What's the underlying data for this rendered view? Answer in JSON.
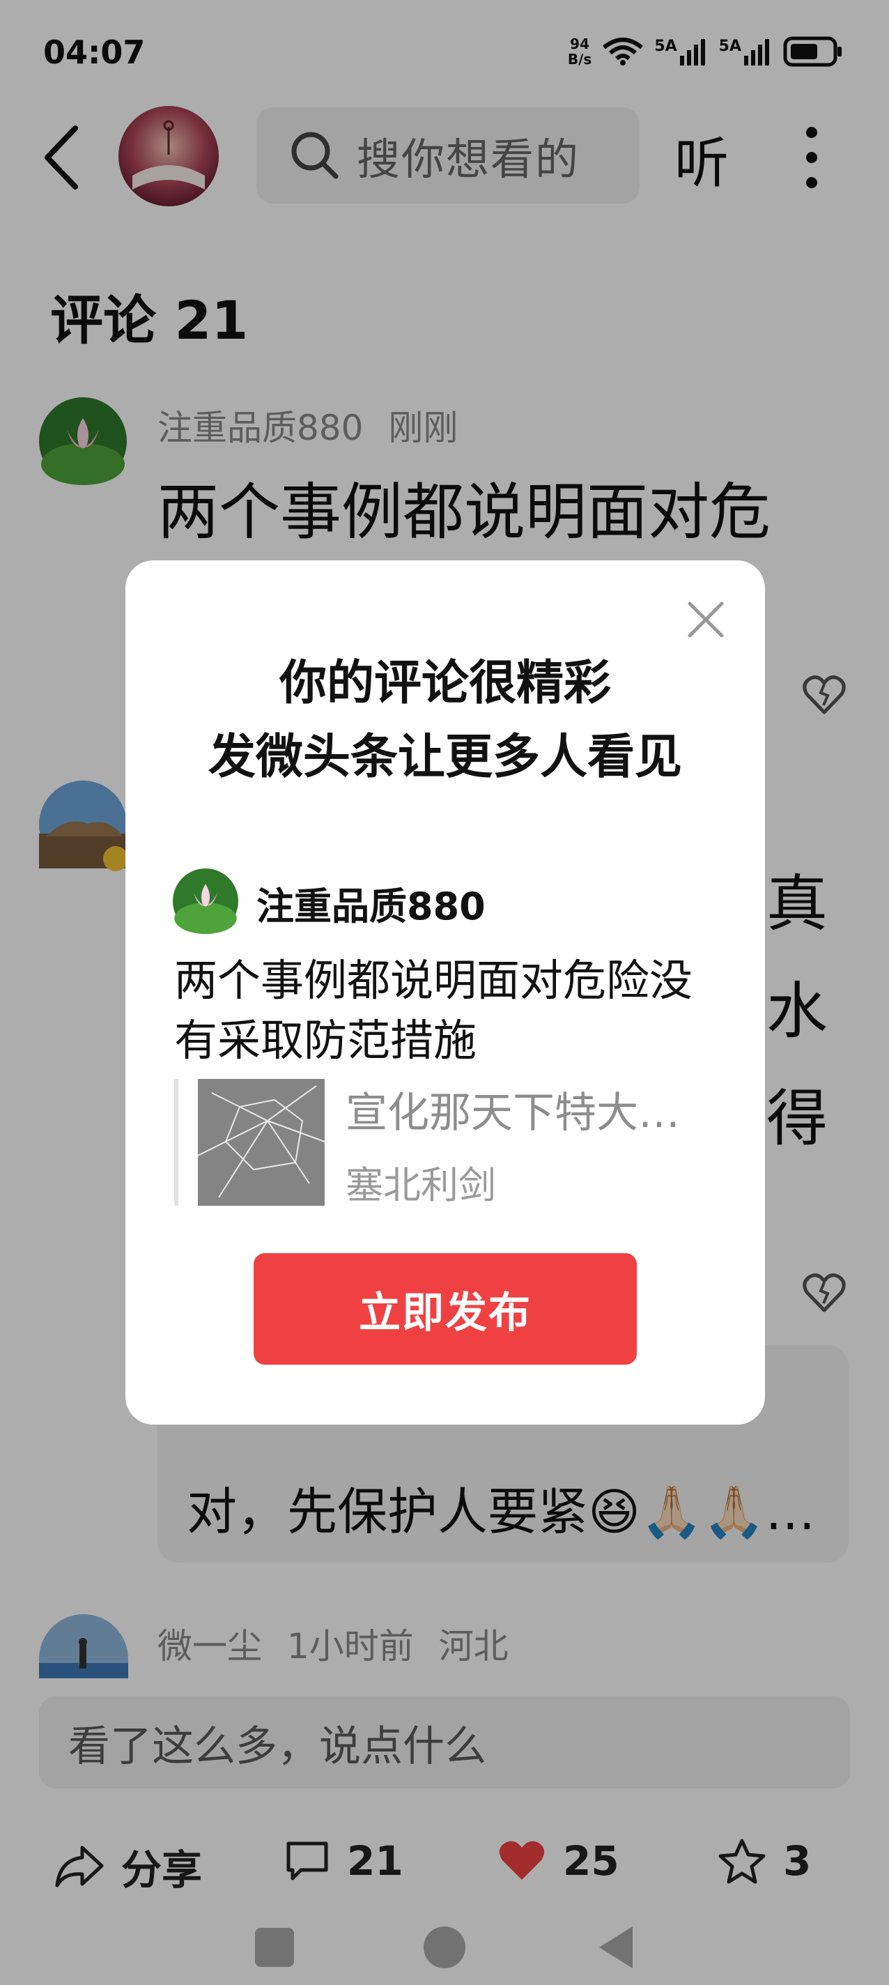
{
  "status_bar": {
    "time": "04:07",
    "net_speed_value": "94",
    "net_speed_unit": "B/s",
    "sim1": "5A",
    "sim2": "5A"
  },
  "header": {
    "search_placeholder": "搜你想看的",
    "listen_label": "听"
  },
  "comments": {
    "title": "评论 21",
    "items": [
      {
        "user": "注重品质880",
        "time": "刚刚",
        "text": "两个事例都说明面对危"
      },
      {
        "text_partial_1": "真",
        "text_partial_2": "水",
        "text_partial_3": "得"
      },
      {
        "reply_text": "对，先保护人要紧😆🙏🏻🙏🏻…"
      },
      {
        "user": "微一尘",
        "time": "1小时前",
        "location": "河北"
      }
    ]
  },
  "input": {
    "placeholder": "看了这么多，说点什么"
  },
  "actions": {
    "share_label": "分享",
    "comment_count": "21",
    "like_count": "25",
    "favorite_count": "3"
  },
  "dialog": {
    "title_line1": "你的评论很精彩",
    "title_line2": "发微头条让更多人看见",
    "user_name": "注重品质880",
    "comment_text": "两个事例都说明面对危险没有采取防范措施",
    "article_title": "宣化那天下特大…",
    "article_author": "塞北利剑",
    "publish_label": "立即发布"
  },
  "colors": {
    "publish_button": "#f04142",
    "like_heart": "#f04142"
  }
}
